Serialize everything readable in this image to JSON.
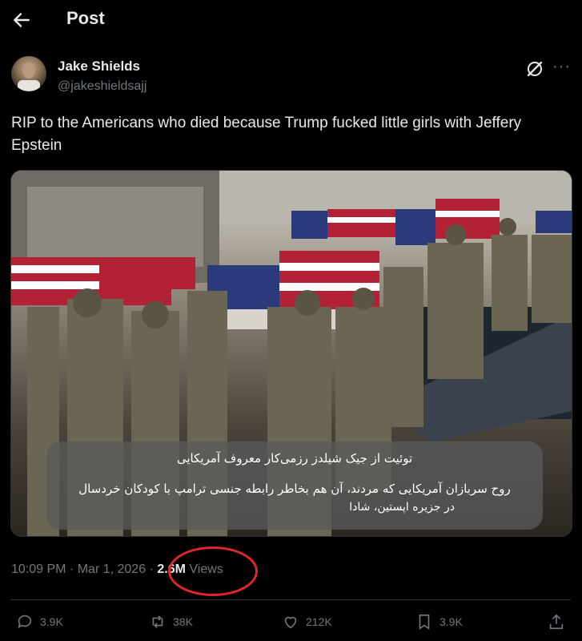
{
  "header": {
    "title": "Post"
  },
  "author": {
    "name": "Jake Shields",
    "handle": "@jakeshieldsajj"
  },
  "tweet": {
    "text": "RIP to the Americans who died because Trump fucked little girls with Jeffery Epstein"
  },
  "media": {
    "overlay_line1": "توئیت از جیک شیلدز رزمی‌کار معروف آمریکایی",
    "overlay_line2": "روح سربازان آمریکایی که مردند، آن هم بخاطر رابطه جنسی ترامپ با کودکان خردسال",
    "overlay_line3": "در جزیره اپستین، شادا"
  },
  "meta": {
    "time": "10:09 PM",
    "date": "Mar 1, 2026",
    "views_count": "2.6M",
    "views_label": "Views"
  },
  "actions": {
    "replies": "3.9K",
    "reposts": "38K",
    "likes": "212K",
    "bookmarks": "3.9K"
  },
  "colors": {
    "background": "#000000",
    "text": "#e7e9ea",
    "muted": "#71767b",
    "highlight_circle": "#e0262b"
  }
}
